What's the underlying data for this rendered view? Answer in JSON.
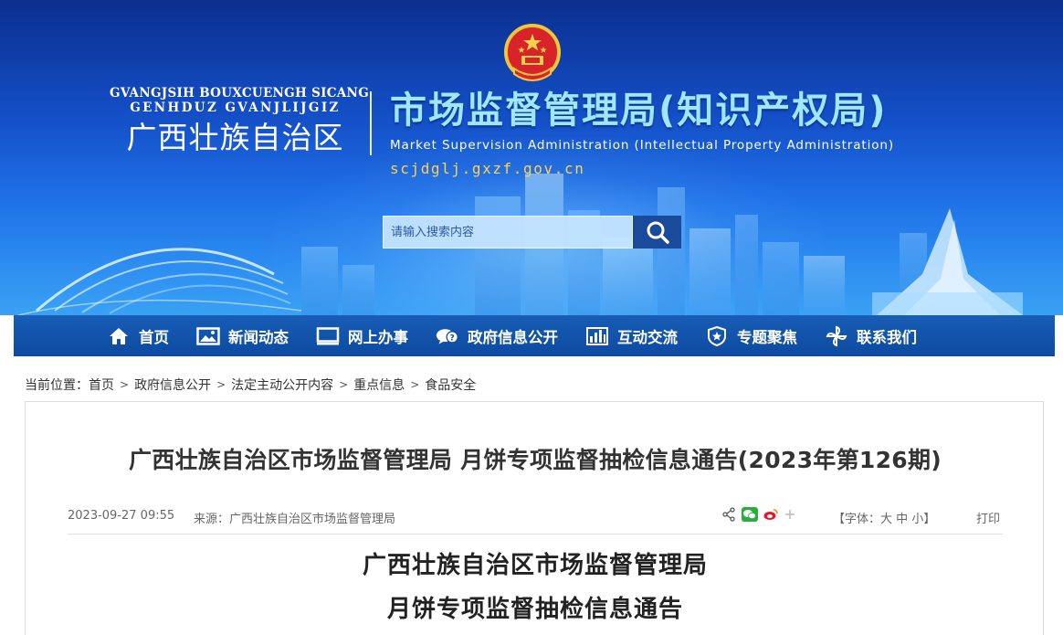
{
  "header": {
    "region_en_line1": "GVANGJSIH BOUXCUENGH SICANG",
    "region_en_line2": "GENHDUZ GVANJLIJGIZ",
    "region_cn": "广西壮族自治区",
    "agency_cn": "市场监督管理局(知识产权局)",
    "agency_en": "Market Supervision Administration  (Intellectual Property Administration)",
    "domain": "scjdglj.gxzf.gov.cn",
    "emblem_icon": "national-emblem-icon"
  },
  "search": {
    "placeholder": "请输入搜索内容",
    "button_icon": "search-icon"
  },
  "nav": {
    "items": [
      {
        "label": "首页",
        "icon": "home-icon"
      },
      {
        "label": "新闻动态",
        "icon": "image-icon"
      },
      {
        "label": "网上办事",
        "icon": "monitor-icon"
      },
      {
        "label": "政府信息公开",
        "icon": "chat-icon"
      },
      {
        "label": "互动交流",
        "icon": "bar-chart-icon"
      },
      {
        "label": "专题聚焦",
        "icon": "shield-icon"
      },
      {
        "label": "联系我们",
        "icon": "pinwheel-icon"
      }
    ]
  },
  "breadcrumb": {
    "prefix": "当前位置：",
    "items": [
      "首页",
      "政府信息公开",
      "法定主动公开内容",
      "重点信息",
      "食品安全"
    ]
  },
  "article": {
    "title": "广西壮族自治区市场监督管理局 月饼专项监督抽检信息通告(2023年第126期)",
    "date": "2023-09-27 09:55",
    "source_label": "来源：",
    "source": "广西壮族自治区市场监督管理局",
    "share_icons": [
      "share-icon",
      "wechat-icon",
      "weibo-icon",
      "plus-icon"
    ],
    "font_size_prefix": "【字体：",
    "font_size_options": [
      "大",
      "中",
      "小"
    ],
    "font_size_suffix": "】",
    "print_label": "打印",
    "doc_heading_line1": "广西壮族自治区市场监督管理局",
    "doc_heading_line2": "月饼专项监督抽检信息通告"
  },
  "colors": {
    "nav_bg": "#0d4aa0",
    "agency_title": "#9fe6ff",
    "domain_text": "#ffd34d",
    "search_button": "#1a4a9c"
  }
}
